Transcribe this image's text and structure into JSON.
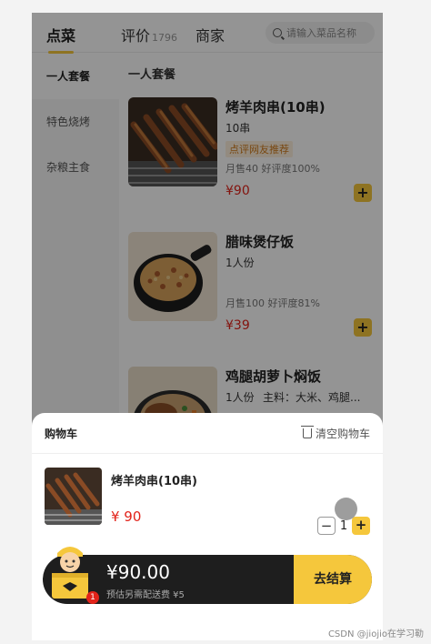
{
  "header": {
    "tabs": [
      {
        "label": "点菜"
      },
      {
        "label": "评价",
        "count": "1796"
      },
      {
        "label": "商家"
      }
    ],
    "search_placeholder": "请输入菜品名称"
  },
  "sidebar": {
    "items": [
      {
        "label": "一人套餐"
      },
      {
        "label": "特色烧烤"
      },
      {
        "label": "杂粮主食"
      }
    ]
  },
  "menu": {
    "section_title": "一人套餐",
    "dishes": [
      {
        "name": "烤羊肉串(10串)",
        "spec": "10串",
        "tag": "点评网友推荐",
        "stats": "月售40  好评度100%",
        "price": "¥90"
      },
      {
        "name": "腊味煲仔饭",
        "spec": "1人份",
        "stats": "月售100  好评度81%",
        "price": "¥39"
      },
      {
        "name": "鸡腿胡萝卜焖饭",
        "spec": "1人份",
        "spec2": "主料：大米、鸡腿..."
      }
    ]
  },
  "cart": {
    "title": "购物车",
    "clear_label": "清空购物车",
    "items": [
      {
        "name": "烤羊肉串(10串)",
        "price": "¥ 90",
        "quantity": "1"
      }
    ],
    "minus_label": "−",
    "plus_label": "+",
    "badge_count": "1",
    "total": "¥90.00",
    "delivery_note": "预估另需配送费 ¥5",
    "checkout_label": "去结算"
  },
  "add_label": "+",
  "watermark": "CSDN @jiojio在学习勒",
  "colors": {
    "accent": "#f5c73c",
    "price": "#e2231a",
    "bar": "#1e1e1e"
  }
}
